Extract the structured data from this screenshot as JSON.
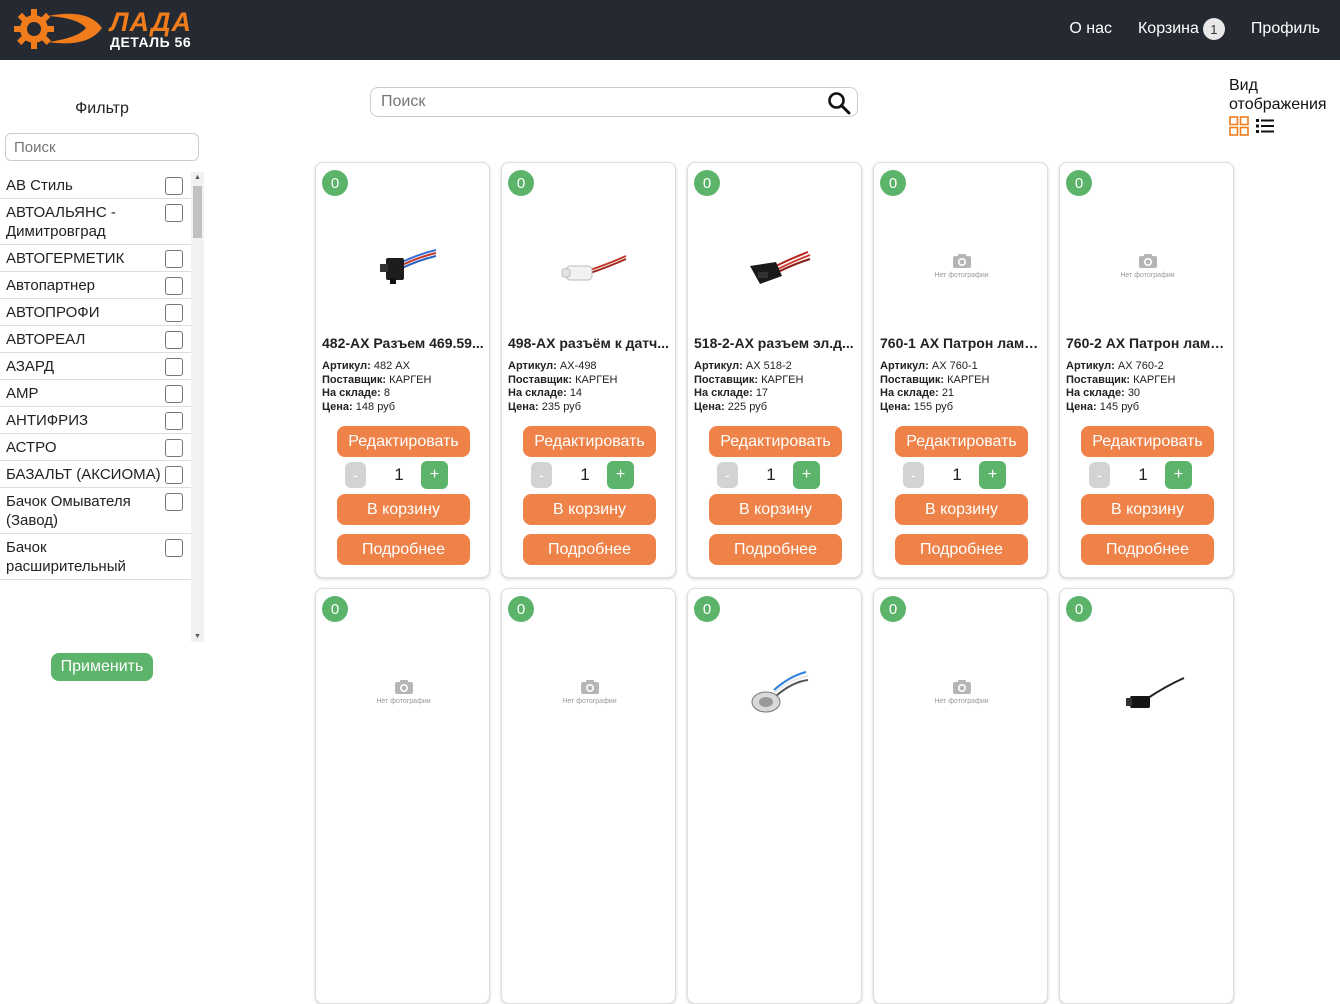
{
  "header": {
    "logo_line1": "ЛАДА",
    "logo_line2": "ДЕТАЛЬ 56",
    "nav": {
      "about": "О нас",
      "cart": "Корзина",
      "cart_count": "1",
      "profile": "Профиль"
    }
  },
  "sidebar": {
    "filter_title": "Фильтр",
    "search_placeholder": "Поиск",
    "brands": [
      "АВ Стиль",
      "АВТОАЛЬЯНС - Димитровград",
      "АВТОГЕРМЕТИК",
      "Автопартнер",
      "АВТОПРОФИ",
      "АВТОРЕАЛ",
      "АЗАРД",
      "АМР",
      "АНТИФРИЗ",
      "АСТРО",
      "БАЗАЛЬТ (АКСИОМА)",
      "Бачок Омывателя (Завод)",
      "Бачок расширительный"
    ],
    "apply_label": "Применить"
  },
  "search": {
    "placeholder": "Поиск"
  },
  "view_mode": {
    "label": "Вид отображения"
  },
  "labels": {
    "sku": "Артикул:",
    "supplier": "Поставщик:",
    "stock": "На складе:",
    "price": "Цена:",
    "edit": "Редактировать",
    "to_cart": "В корзину",
    "details": "Подробнее",
    "no_photo": "Нет фотографии"
  },
  "products": [
    {
      "badge": "0",
      "title": "482-АХ Разъем 469.59...",
      "sku": "482 АХ",
      "supplier": "КАРГЕН",
      "stock": "8",
      "price": "148 руб",
      "qty": "1",
      "image": "connector-black"
    },
    {
      "badge": "0",
      "title": "498-АХ разъём к датч...",
      "sku": "АХ-498",
      "supplier": "КАРГЕН",
      "stock": "14",
      "price": "235 руб",
      "qty": "1",
      "image": "connector-white"
    },
    {
      "badge": "0",
      "title": "518-2-АХ разъем эл.д...",
      "sku": "АХ 518-2",
      "supplier": "КАРГЕН",
      "stock": "17",
      "price": "225 руб",
      "qty": "1",
      "image": "connector-red"
    },
    {
      "badge": "0",
      "title": "760-1 АХ Патрон ламп...",
      "sku": "АХ 760-1",
      "supplier": "КАРГЕН",
      "stock": "21",
      "price": "155 руб",
      "qty": "1",
      "image": "none"
    },
    {
      "badge": "0",
      "title": "760-2 АХ Патрон ламп...",
      "sku": "АХ 760-2",
      "supplier": "КАРГЕН",
      "stock": "30",
      "price": "145 руб",
      "qty": "1",
      "image": "none"
    },
    {
      "badge": "0",
      "image": "none"
    },
    {
      "badge": "0",
      "image": "none"
    },
    {
      "badge": "0",
      "image": "socket-blue"
    },
    {
      "badge": "0",
      "image": "none"
    },
    {
      "badge": "0",
      "image": "connector-small"
    }
  ],
  "colors": {
    "header_bg": "#252a32",
    "brand_orange": "#f07c1c",
    "button_orange": "#ee8248",
    "green": "#5cb36a"
  }
}
